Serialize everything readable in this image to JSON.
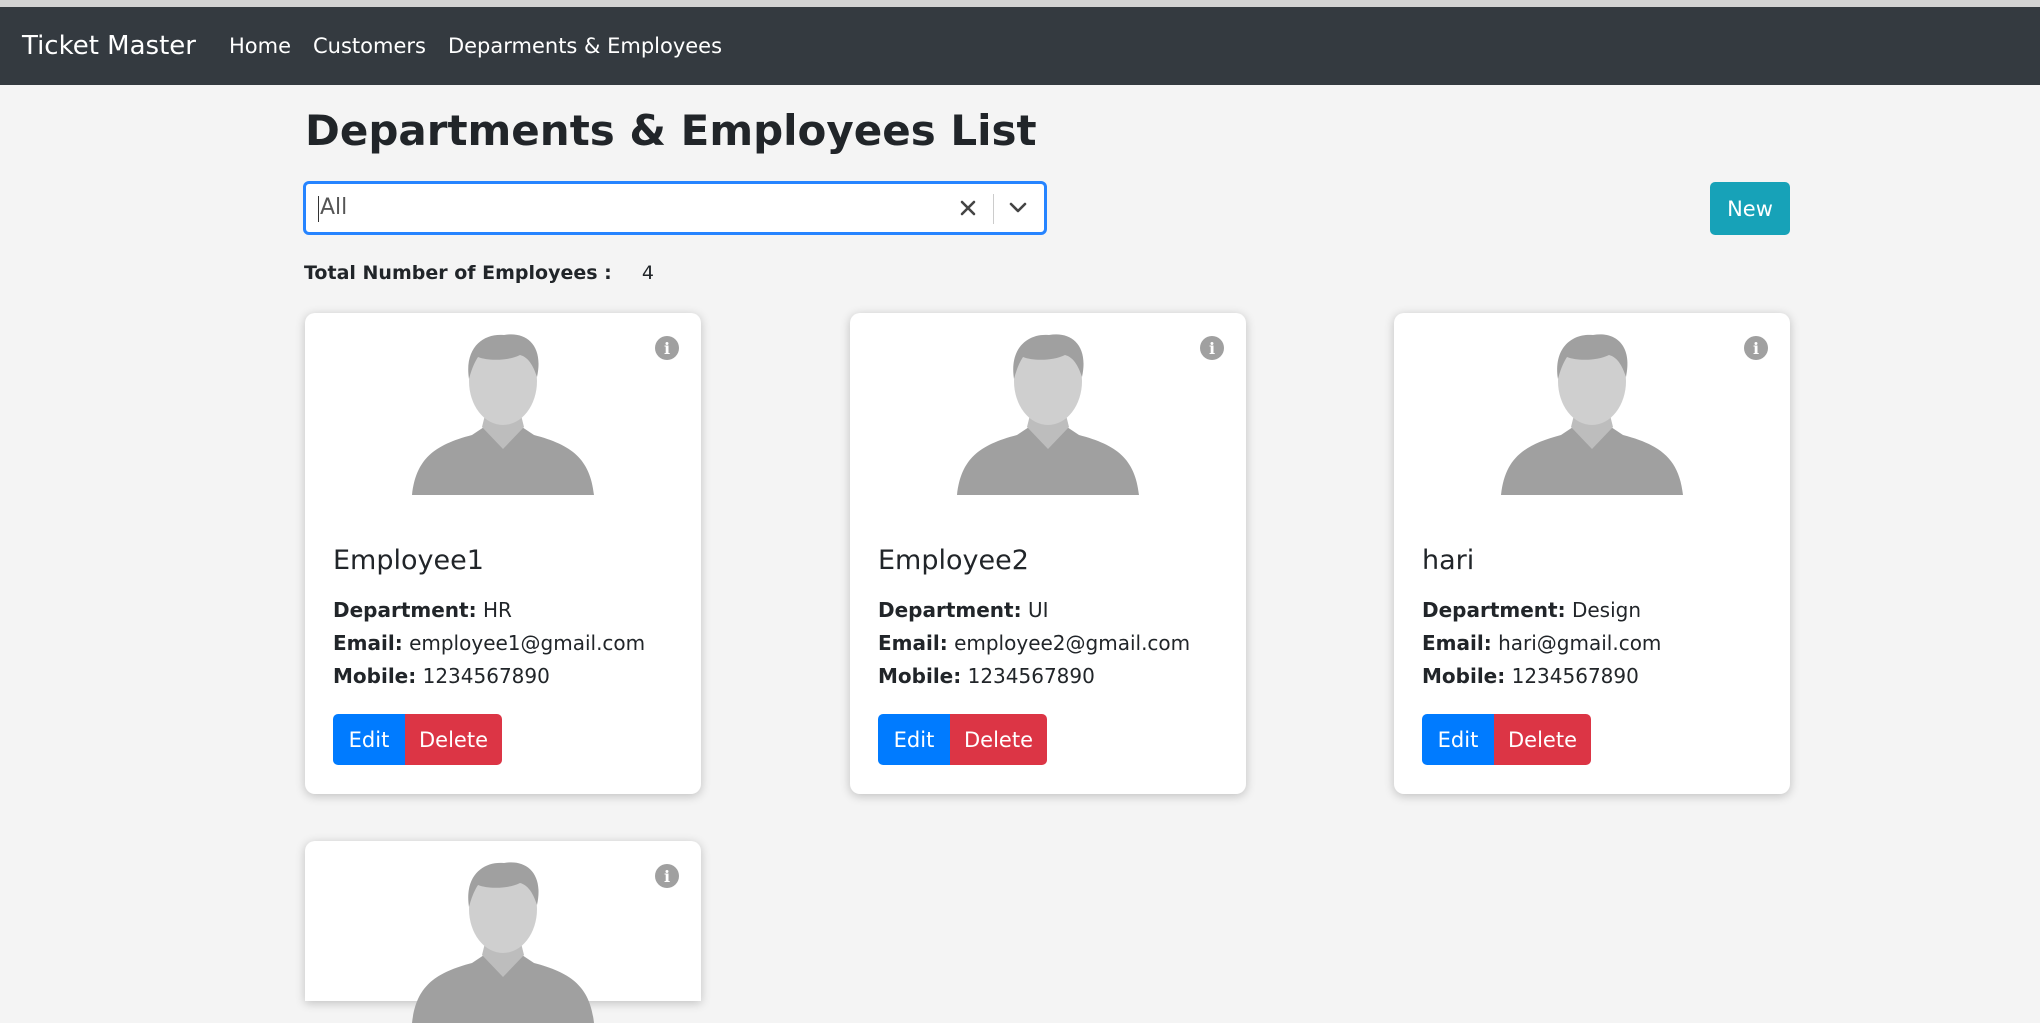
{
  "navbar": {
    "brand": "Ticket Master",
    "links": [
      "Home",
      "Customers",
      "Deparments & Employees"
    ]
  },
  "page": {
    "title": "Departments & Employees List"
  },
  "filter": {
    "selected": "All"
  },
  "toolbar": {
    "new_label": "New"
  },
  "summary": {
    "total_label": "Total Number of Employees :",
    "total_count": "4"
  },
  "labels": {
    "department": "Department:",
    "email": "Email:",
    "mobile": "Mobile:",
    "edit": "Edit",
    "delete": "Delete"
  },
  "employees": [
    {
      "name": "Employee1",
      "department": "HR",
      "email": "employee1@gmail.com",
      "mobile": "1234567890"
    },
    {
      "name": "Employee2",
      "department": "UI",
      "email": "employee2@gmail.com",
      "mobile": "1234567890"
    },
    {
      "name": "hari",
      "department": "Design",
      "email": "hari@gmail.com",
      "mobile": "1234567890"
    }
  ],
  "colors": {
    "navbar_bg": "#343a40",
    "new_button": "#17a2b8",
    "edit_button": "#007bff",
    "delete_button": "#dc3545",
    "select_focus": "#2684ff"
  },
  "icons": {
    "info": "info-circle-icon",
    "avatar": "user-placeholder-icon",
    "clear": "close-icon",
    "dropdown": "chevron-down-icon"
  }
}
